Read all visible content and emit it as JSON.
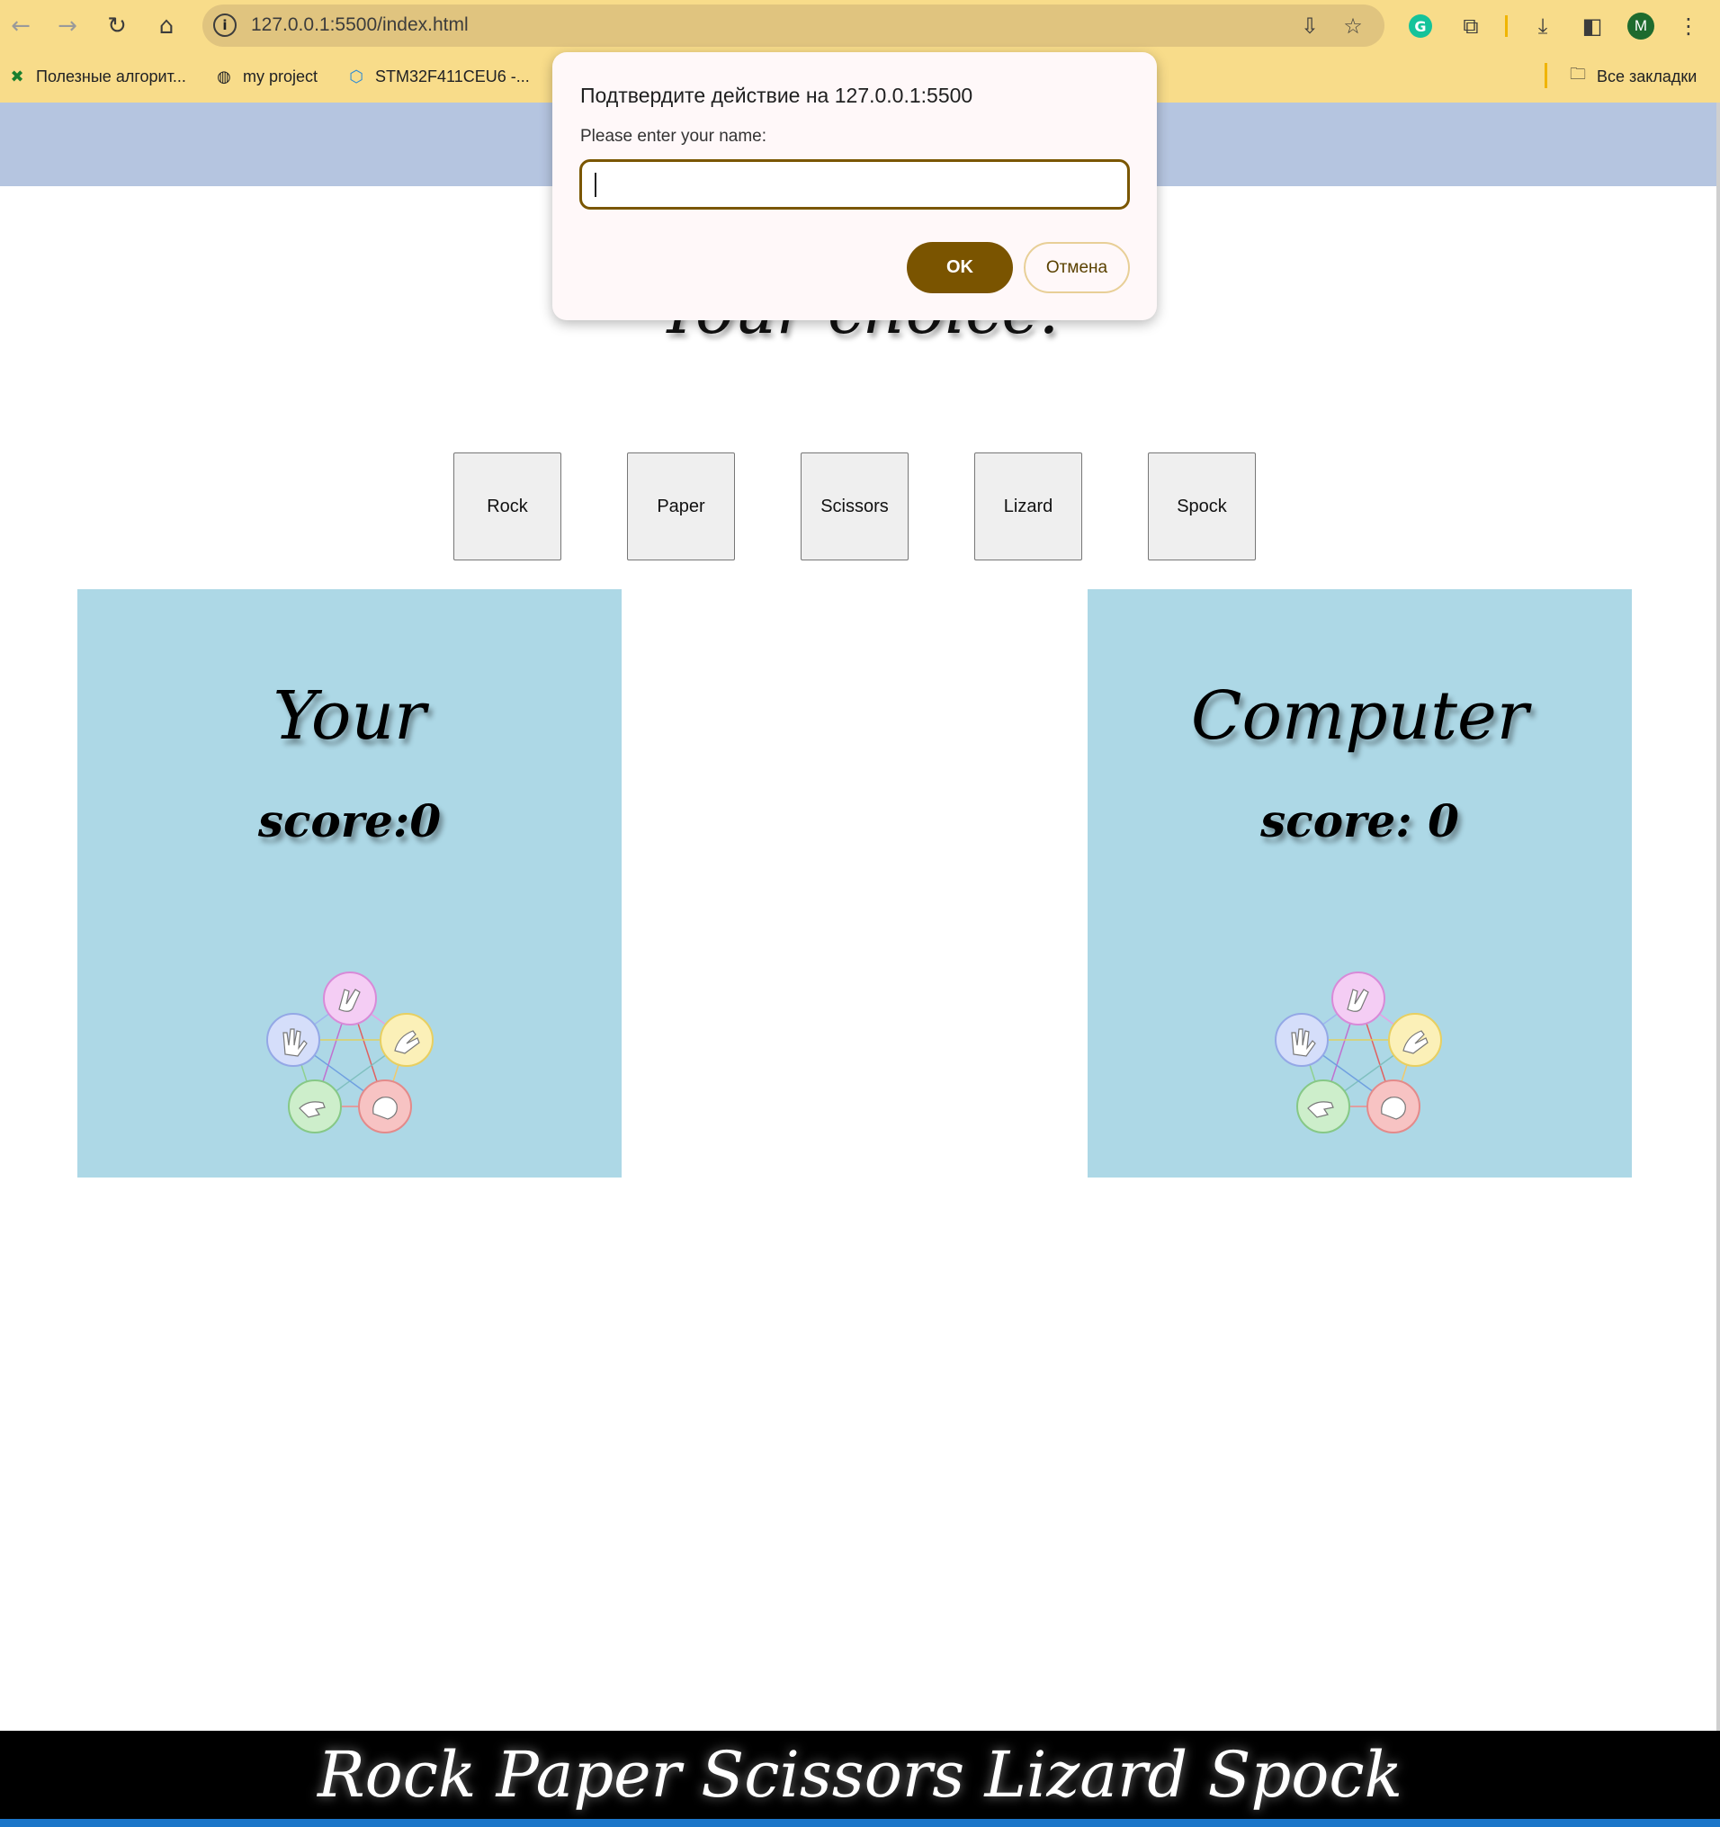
{
  "browser": {
    "url": "127.0.0.1:5500/index.html",
    "profile_initial": "M",
    "bookmarks": [
      {
        "label": "Полезные алгорит...",
        "icon": "tools-icon"
      },
      {
        "label": "my project",
        "icon": "globe-icon"
      },
      {
        "label": "STM32F411CEU6 -...",
        "icon": "hexagon-icon"
      }
    ],
    "all_bookmarks_label": "Все закладки"
  },
  "dialog": {
    "title": "Подтвердите действие на 127.0.0.1:5500",
    "message": "Please enter your name:",
    "input_value": "",
    "ok_label": "OK",
    "cancel_label": "Отмена"
  },
  "page": {
    "choice_title": "Your choice:",
    "choices": [
      "Rock",
      "Paper",
      "Scissors",
      "Lizard",
      "Spock"
    ],
    "player_panel": {
      "title": "Your",
      "score_text": "score:0"
    },
    "computer_panel": {
      "title": "Computer",
      "score_text": "score: 0"
    },
    "footer_text": "Rock Paper Scissors Lizard Spock"
  },
  "colors": {
    "browser_chrome": "#f8dc8a",
    "header_band": "#b5c5e0",
    "panel_bg": "#add8e6",
    "dialog_accent": "#7a5400",
    "footer_bg": "#000000"
  }
}
